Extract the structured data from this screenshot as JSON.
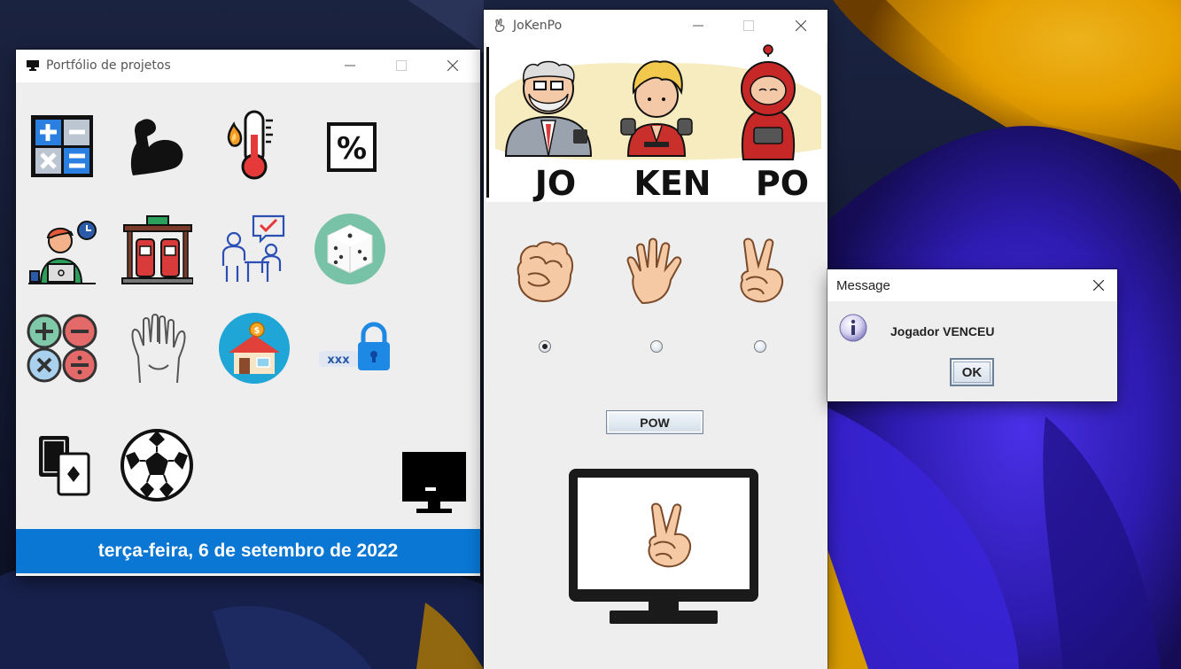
{
  "portfolio_window": {
    "title": "Portfólio de projetos",
    "date_text": "terça-feira, 6 de setembro de 2022",
    "date_bar_color": "#0a77d4",
    "icons": [
      "calculator-icon",
      "muscle-arm-icon",
      "fever-thermometer-icon",
      "percent-icon",
      "remote-worker-icon",
      "fuel-station-icon",
      "survey-meeting-icon",
      "dice-icon",
      "math-operations-icon",
      "high-five-icon",
      "house-savings-icon",
      "password-lock-icon",
      "card-game-icon",
      "soccer-ball-icon",
      "monitor-icon"
    ]
  },
  "jokenpo_window": {
    "title": "JoKenPo",
    "banner_words": [
      "JO",
      "KEN",
      "PO"
    ],
    "choices": [
      "rock",
      "paper",
      "scissors"
    ],
    "selected_choice": "rock",
    "pow_button": "POW",
    "computer_choice": "scissors"
  },
  "message_dialog": {
    "title": "Message",
    "text": "Jogador VENCEU",
    "ok_button": "OK"
  },
  "colors": {
    "wallpaper_purple": "#3b22c9",
    "wallpaper_yellow": "#f2b400",
    "skin": "#f5c9a3"
  }
}
